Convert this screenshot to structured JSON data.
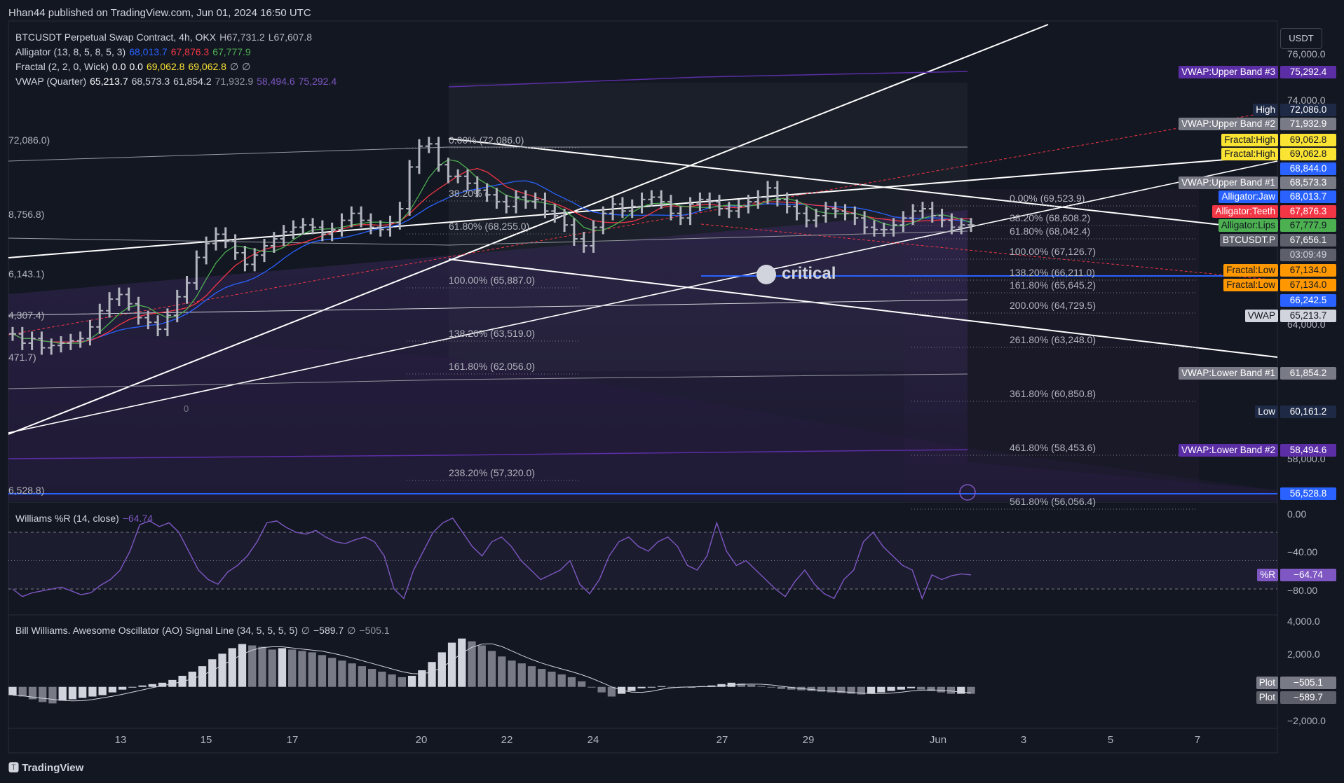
{
  "publisher": "Hhan44 published on TradingView.com, Jun 01, 2024 16:50 UTC",
  "footer_brand": "TradingView",
  "currency_button": "USDT",
  "legends": {
    "symbol": {
      "name": "BTCUSDT Perpetual Swap Contract, 4h, OKX",
      "h_label": "H",
      "h_val": "67,731.2",
      "l_label": "L",
      "l_val": "67,607.8"
    },
    "alligator": {
      "name": "Alligator (13, 8, 5, 8, 5, 3)",
      "jaw": "68,013.7",
      "teeth": "67,876.3",
      "lips": "67,777.9"
    },
    "fractal": {
      "name": "Fractal (2, 2, 0, Wick)",
      "v1": "0.0",
      "v2": "0.0",
      "v3": "69,062.8",
      "v4": "69,062.8",
      "v5": "∅",
      "v6": "∅"
    },
    "vwap": {
      "name": "VWAP (Quarter)",
      "v1": "65,213.7",
      "v2": "68,573.3",
      "v3": "61,854.2",
      "v4": "71,932.9",
      "v5": "58,494.6",
      "v6": "75,292.4"
    },
    "williams": {
      "name": "Williams %R (14, close)",
      "value": "−64.74"
    },
    "ao": {
      "name": "Bill Williams. Awesome Oscillator (AO) Signal Line (34, 5, 5, 5, 5)",
      "s1": "∅",
      "v1": "−589.7",
      "s2": "∅",
      "v2": "−505.1"
    }
  },
  "colors": {
    "bg": "#131722",
    "jaw": "#2962ff",
    "teeth": "#f23645",
    "lips": "#4caf50",
    "vwap_purple": "#5b2ea6",
    "fractal_yellow": "#fbe333",
    "fractal_orange": "#ff9800"
  },
  "price_axis": {
    "labels": [
      "76,000.0",
      "74,000.0",
      "64,000.0",
      "58,000.0"
    ]
  },
  "price_tags": [
    {
      "label": "VWAP:Upper Band #3",
      "value": "75,292.4",
      "bg": "#5b2ea6",
      "fg": "#ffffff"
    },
    {
      "label": "High",
      "value": "72,086.0",
      "bg": "#1e2a45",
      "fg": "#ffffff"
    },
    {
      "label": "VWAP:Upper Band #2",
      "value": "71,932.9",
      "bg": "#787b86",
      "fg": "#ffffff"
    },
    {
      "label": "Fractal:High",
      "value": "69,062.8",
      "bg": "#fbe333",
      "fg": "#131722"
    },
    {
      "label": "Fractal:High",
      "value": "69,062.8",
      "bg": "#fbe333",
      "fg": "#131722"
    },
    {
      "label": "",
      "value": "68,844.0",
      "bg": "#2962ff",
      "fg": "#ffffff"
    },
    {
      "label": "VWAP:Upper Band #1",
      "value": "68,573.3",
      "bg": "#787b86",
      "fg": "#ffffff"
    },
    {
      "label": "Alligator:Jaw",
      "value": "68,013.7",
      "bg": "#2962ff",
      "fg": "#ffffff"
    },
    {
      "label": "Alligator:Teeth",
      "value": "67,876.3",
      "bg": "#f23645",
      "fg": "#ffffff"
    },
    {
      "label": "Alligator:Lips",
      "value": "67,777.9",
      "bg": "#4caf50",
      "fg": "#131722"
    },
    {
      "label": "BTCUSDT.P",
      "value": "67,656.1",
      "bg": "#5d606b",
      "fg": "#ffffff"
    },
    {
      "label": "",
      "value": "03:09:49",
      "bg": "#5d606b",
      "fg": "#d1d4dc"
    },
    {
      "label": "Fractal:Low",
      "value": "67,134.0",
      "bg": "#ff9800",
      "fg": "#131722"
    },
    {
      "label": "Fractal:Low",
      "value": "67,134.0",
      "bg": "#ff9800",
      "fg": "#131722"
    },
    {
      "label": "",
      "value": "66,242.5",
      "bg": "#2962ff",
      "fg": "#ffffff"
    },
    {
      "label": "VWAP",
      "value": "65,213.7",
      "bg": "#d1d4dc",
      "fg": "#131722"
    },
    {
      "label": "VWAP:Lower Band #1",
      "value": "61,854.2",
      "bg": "#787b86",
      "fg": "#ffffff"
    },
    {
      "label": "Low",
      "value": "60,161.2",
      "bg": "#1e2a45",
      "fg": "#ffffff"
    },
    {
      "label": "VWAP:Lower Band #2",
      "value": "58,494.6",
      "bg": "#5b2ea6",
      "fg": "#ffffff"
    },
    {
      "label": "",
      "value": "56,528.8",
      "bg": "#2962ff",
      "fg": "#ffffff"
    }
  ],
  "fib_left": [
    "0.00% (72,086.0)",
    "38.20% (",
    "61.80% (68,255.0)",
    "100.00% (65,887.0)",
    "138.20% (63,519.0)",
    "161.80% (62,056.0)",
    "238.20% (57,320.0)"
  ],
  "fib_right": [
    "0.00% (69,523.9)",
    "38.20% (68,608.2)",
    "61.80% (68,042.4)",
    "100.00% (67,126.7)",
    "138.20% (66,211.0)",
    "161.80% (65,645.2)",
    "200.00% (64,729.5)",
    "261.80% (63,248.0)",
    "361.80% (60,850.8)",
    "461.80% (58,453.6)",
    "561.80% (56,056.4)"
  ],
  "left_edge_labels": [
    "72,086.0)",
    "8,756.8)",
    "6,143.1)",
    "4,307.4)",
    "471.7)",
    "6,528.8)"
  ],
  "watermark": "critical",
  "zero_label": "0",
  "wr_axis": [
    "0.00",
    "−40.00",
    "−80.00"
  ],
  "wr_tag": {
    "label": "%R",
    "value": "−64.74"
  },
  "ao_axis": [
    "4,000.0",
    "2,000.0",
    "−2,000.0"
  ],
  "ao_tags": [
    {
      "label": "Plot",
      "value": "−505.1"
    },
    {
      "label": "Plot",
      "value": "−589.7"
    }
  ],
  "time_axis": [
    "13",
    "15",
    "17",
    "20",
    "22",
    "24",
    "27",
    "29",
    "Jun",
    "3",
    "5",
    "7"
  ],
  "chart_data": {
    "type": "bar",
    "symbol": "BTCUSDT Perpetual Swap Contract",
    "timeframe": "4h",
    "exchange": "OKX",
    "ylim": [
      55800,
      76500
    ],
    "ohlc_close_approx": [
      63000,
      62600,
      62800,
      62400,
      62500,
      62600,
      62700,
      62800,
      63300,
      64000,
      64500,
      64700,
      64300,
      63700,
      63500,
      63200,
      63800,
      64600,
      65200,
      66300,
      66900,
      67300,
      67000,
      66500,
      66000,
      66400,
      66800,
      67100,
      67400,
      67600,
      67700,
      67600,
      67300,
      67500,
      67900,
      68200,
      67900,
      67600,
      67500,
      67800,
      68400,
      70200,
      71100,
      71200,
      70300,
      69800,
      69800,
      69500,
      69200,
      69000,
      68700,
      68500,
      68900,
      68700,
      68800,
      68300,
      68100,
      67700,
      67100,
      66800,
      67600,
      68200,
      68600,
      68300,
      68500,
      68800,
      68900,
      68700,
      68200,
      68000,
      68600,
      68800,
      68700,
      68400,
      68300,
      68500,
      68700,
      68900,
      69300,
      68800,
      68500,
      68200,
      67900,
      68100,
      68400,
      68300,
      68200,
      68000,
      67600,
      67500,
      67500,
      67700,
      68000,
      68300,
      68400,
      68100,
      67900,
      67600,
      67700,
      67700
    ],
    "high": 72086.0,
    "low": 60161.2,
    "last": 67656.1,
    "alligator": {
      "jaw": 68013.7,
      "teeth": 67876.3,
      "lips": 67777.9
    },
    "vwap_quarter": {
      "vwap": 65213.7,
      "upper1": 68573.3,
      "lower1": 61854.2,
      "upper2": 71932.9,
      "lower2": 58494.6,
      "upper3": 75292.4
    },
    "fractal_high": 69062.8,
    "fractal_low": 67134.0,
    "williams_r": {
      "ylim": [
        -100,
        0
      ],
      "last": -64.74,
      "values": [
        -80,
        -88,
        -84,
        -82,
        -80,
        -78,
        -82,
        -86,
        -84,
        -76,
        -70,
        -60,
        -40,
        -12,
        -8,
        -14,
        -10,
        -20,
        -40,
        -60,
        -70,
        -75,
        -62,
        -55,
        -45,
        -30,
        -10,
        -8,
        -15,
        -20,
        -22,
        -18,
        -25,
        -30,
        -32,
        -28,
        -25,
        -30,
        -45,
        -80,
        -90,
        -60,
        -40,
        -20,
        -10,
        -5,
        -20,
        -35,
        -45,
        -30,
        -25,
        -35,
        -50,
        -60,
        -70,
        -65,
        -60,
        -50,
        -75,
        -85,
        -70,
        -45,
        -30,
        -25,
        -35,
        -40,
        -30,
        -25,
        -35,
        -55,
        -60,
        -45,
        -10,
        -40,
        -55,
        -50,
        -60,
        -70,
        -80,
        -88,
        -72,
        -60,
        -75,
        -85,
        -90,
        -70,
        -60,
        -30,
        -20,
        -35,
        -45,
        -55,
        -60,
        -90,
        -65,
        -70,
        -66,
        -64,
        -65
      ]
    },
    "ao": {
      "ylim": [
        -2600,
        4600
      ],
      "last_plot": -505.1,
      "signal": -589.7,
      "values": [
        -600,
        -700,
        -900,
        -1100,
        -1200,
        -1000,
        -900,
        -800,
        -700,
        -600,
        -400,
        -200,
        0,
        100,
        200,
        300,
        500,
        800,
        1100,
        1500,
        2000,
        2400,
        2800,
        3100,
        3000,
        2900,
        2700,
        2800,
        2700,
        2600,
        2500,
        2300,
        2100,
        1900,
        1700,
        1500,
        1300,
        1100,
        900,
        700,
        800,
        1200,
        1800,
        2500,
        3200,
        3500,
        3300,
        3000,
        2600,
        2200,
        1900,
        1700,
        1500,
        1300,
        1100,
        900,
        700,
        400,
        0,
        -400,
        -700,
        -500,
        -300,
        -100,
        0,
        50,
        0,
        -50,
        0,
        50,
        100,
        200,
        300,
        250,
        150,
        50,
        -50,
        -150,
        -200,
        -250,
        -300,
        -350,
        -400,
        -450,
        -500,
        -550,
        -500,
        -400,
        -300,
        -200,
        -100,
        -200,
        -300,
        -400,
        -500,
        -500,
        -505
      ]
    }
  }
}
